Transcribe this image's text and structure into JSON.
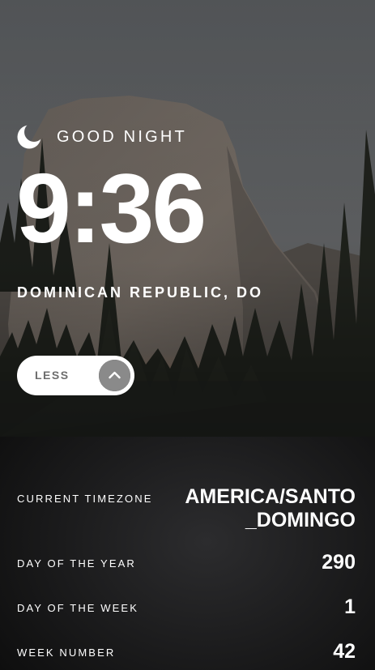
{
  "greeting": {
    "icon": "moon-icon",
    "text": "GOOD NIGHT"
  },
  "clock": {
    "time": "9:36"
  },
  "location": {
    "text": "DOMINICAN REPUBLIC, DO"
  },
  "toggle": {
    "label": "LESS",
    "icon": "chevron-up-icon",
    "expanded": true
  },
  "details": {
    "timezone": {
      "label": "CURRENT TIMEZONE",
      "value": "AMERICA/SANTO_DOMINGO"
    },
    "day_of_year": {
      "label": "DAY OF THE YEAR",
      "value": "290"
    },
    "day_of_week": {
      "label": "DAY OF THE WEEK",
      "value": "1"
    },
    "week_number": {
      "label": "WEEK NUMBER",
      "value": "42"
    }
  },
  "colors": {
    "text": "#ffffff",
    "toggle_bg": "#ffffff",
    "toggle_label": "#6d6d6d",
    "toggle_circle": "#303030",
    "panel_bg": "#1b1b1c"
  }
}
